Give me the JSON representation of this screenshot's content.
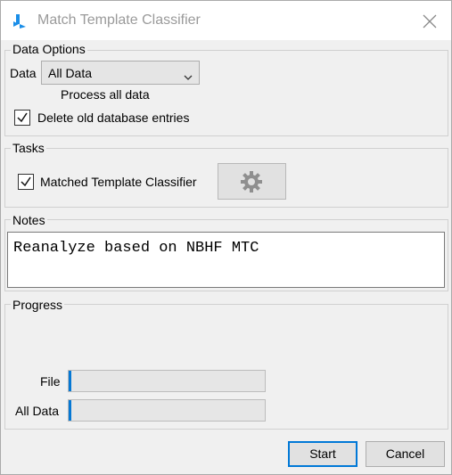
{
  "window": {
    "title": "Match Template Classifier"
  },
  "data_options": {
    "legend": "Data Options",
    "data_label": "Data",
    "data_select_value": "All Data",
    "data_description": "Process all data",
    "delete_label": "Delete old database entries",
    "delete_checked": true
  },
  "tasks": {
    "legend": "Tasks",
    "items": [
      {
        "label": "Matched Template Classifier",
        "checked": true
      }
    ]
  },
  "notes": {
    "legend": "Notes",
    "text": "Reanalyze based on NBHF MTC"
  },
  "progress": {
    "legend": "Progress",
    "file_label": "File",
    "alldata_label": "All Data",
    "file_value": 0,
    "alldata_value": 0
  },
  "buttons": {
    "start": "Start",
    "cancel": "Cancel"
  },
  "colors": {
    "accent": "#0078d7",
    "progress_fill": "#0678d4",
    "icon": "#1a8ee8"
  }
}
